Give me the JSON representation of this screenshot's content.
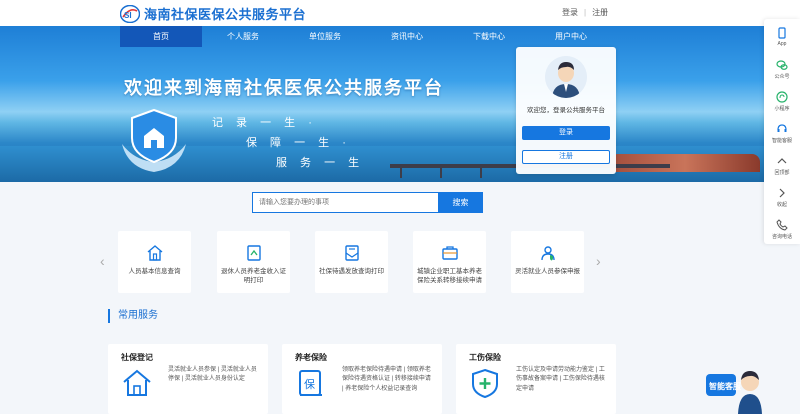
{
  "header": {
    "logo_mark": "SI",
    "title": "海南社保医保公共服务平台",
    "login": "登录",
    "separator": "|",
    "register": "注册"
  },
  "nav": [
    {
      "label": "首页",
      "active": true
    },
    {
      "label": "个人服务"
    },
    {
      "label": "单位服务"
    },
    {
      "label": "资讯中心"
    },
    {
      "label": "下载中心"
    },
    {
      "label": "用户中心"
    }
  ],
  "hero": {
    "headline": "欢迎来到海南社保医保公共服务平台",
    "slogans": [
      "记 录 一 生 ·",
      "保 障 一 生 ·",
      "服 务 一 生"
    ]
  },
  "login_card": {
    "welcome": "欢迎您，登录公共服务平台",
    "login_button": "登录",
    "register_button": "注册"
  },
  "search": {
    "placeholder": "请输入您要办理的事项",
    "button": "搜索"
  },
  "quick_services": [
    {
      "label": "人员基本信息查询",
      "icon": "home-icon"
    },
    {
      "label": "退休人员养老金收入证明打印",
      "icon": "document-icon"
    },
    {
      "label": "社保待遇发放查询打印",
      "icon": "mail-icon"
    },
    {
      "label": "城镇企业职工基本养老保险关系转移接续申请",
      "icon": "briefcase-icon"
    },
    {
      "label": "灵活就业人员参保申报",
      "icon": "person-shield-icon"
    }
  ],
  "arrows": {
    "prev": "‹",
    "next": "›"
  },
  "common": {
    "title": "常用服务",
    "cards": [
      {
        "title": "社保登记",
        "desc": "灵活就业人员参保 | 灵活就业人员停保 | 灵活就业人员身份认定",
        "icon": "house-icon"
      },
      {
        "title": "养老保险",
        "desc": "领取养老保险待遇申请 | 领取养老保险待遇资格认证 | 转移接续申请 | 养老保险个人权益记录查询",
        "icon": "insurance-book-icon",
        "glyph": "保"
      },
      {
        "title": "工伤保险",
        "desc": "工伤认定及申请劳动能力鉴定 | 工伤事故备案申请 | 工伤保险待遇核定申请",
        "icon": "medical-cross-icon"
      }
    ]
  },
  "sidebar": [
    {
      "label": "App",
      "icon": "phone-icon"
    },
    {
      "label": "公众号",
      "icon": "wechat-icon"
    },
    {
      "label": "小程序",
      "icon": "mini-program-icon"
    },
    {
      "label": "智能客服",
      "icon": "customer-service-icon"
    },
    {
      "label": "回顶部",
      "icon": "arrow-up-icon"
    },
    {
      "label": "收起",
      "icon": "arrow-right-icon"
    },
    {
      "label": "咨询电话",
      "icon": "phone-call-icon"
    }
  ],
  "mascot": {
    "text": "智能客服"
  },
  "colors": {
    "brand": "#1677e0",
    "nav_active": "#1357b8",
    "title_blue": "#1a6fd1"
  }
}
